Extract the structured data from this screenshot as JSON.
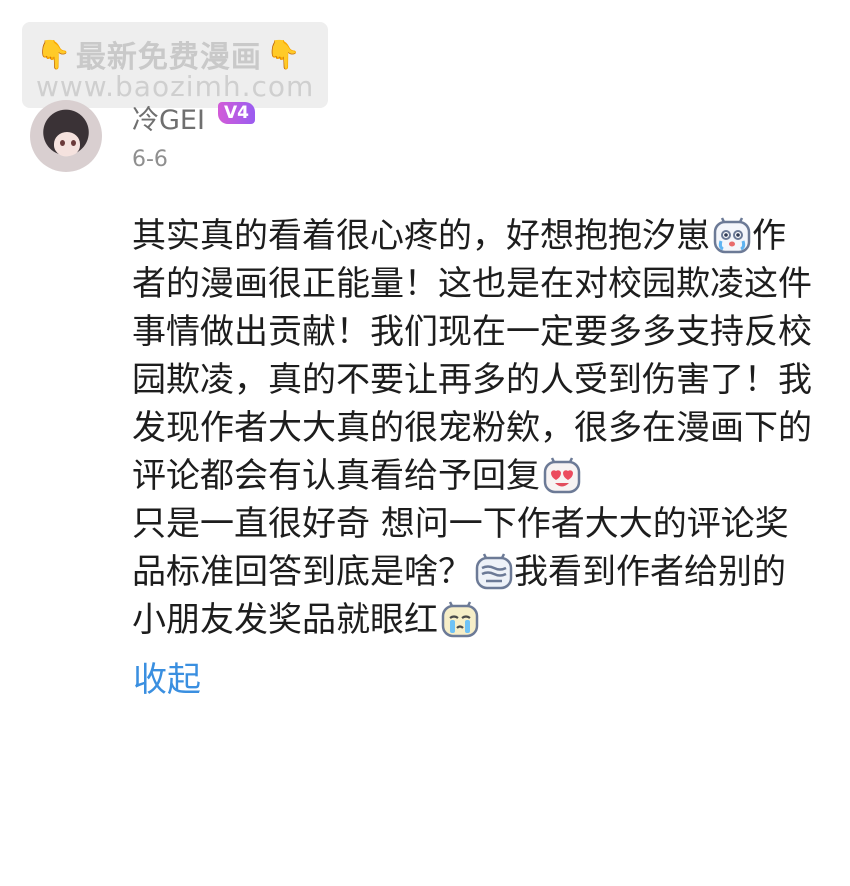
{
  "watermark": {
    "line1": "最新免费漫画",
    "hand_icon": "👇",
    "line2": "www.baozimh.com"
  },
  "user": {
    "name": "冷GEI",
    "level": "V4",
    "date": "6-6"
  },
  "comment": {
    "segments": [
      "其实真的看着很心疼的，好想抱抱汐崽",
      "作者的漫画很正能量！这也是在对校园欺凌这件事情做出贡献！我们现在一定要多多支持反校园欺凌，真的不要让再多的人受到伤害了！我发现作者大大真的很宠粉欸，很多在漫画下的评论都会有认真看给予回复",
      "只是一直很好奇 想问一下作者大大的评论奖品标准回答到底是啥？",
      "我看到作者给别的小朋友发奖品就眼红"
    ],
    "emojis": [
      "crying-face-icon",
      "heart-eyes-icon",
      "confused-face-icon",
      "teary-face-icon"
    ]
  },
  "actions": {
    "collapse_label": "收起"
  },
  "colors": {
    "link": "#3a8fe0",
    "vip_badge": "#b35ce4",
    "text": "#1d1d1d",
    "meta": "#8f8f8f"
  }
}
